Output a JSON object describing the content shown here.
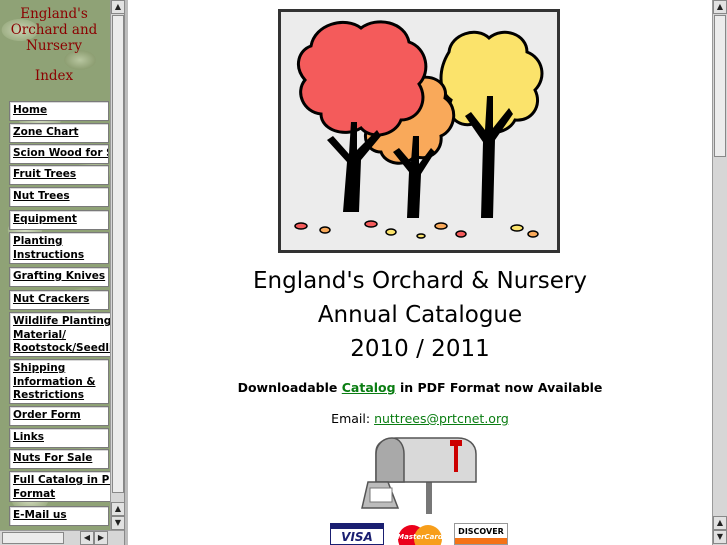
{
  "sidebar": {
    "site_title": "England's Orchard and Nursery",
    "index_label": "Index",
    "items": [
      {
        "label": "Home"
      },
      {
        "label": "Zone Chart"
      },
      {
        "label": "Scion Wood for Sale"
      },
      {
        "label": "Fruit Trees"
      },
      {
        "label": "Nut Trees"
      },
      {
        "label": "Equipment"
      },
      {
        "label": "Planting Instructions"
      },
      {
        "label": "Grafting Knives"
      },
      {
        "label": "Nut Crackers"
      },
      {
        "label": "Wildlife Planting Material/ Rootstock/Seedlings"
      },
      {
        "label": "Shipping Information & Restrictions"
      },
      {
        "label": "Order Form"
      },
      {
        "label": "Links"
      },
      {
        "label": "Nuts For Sale"
      },
      {
        "label": "Full Catalog in PDF Format"
      },
      {
        "label": "E-Mail us"
      }
    ]
  },
  "main": {
    "heading_line1": "England's Orchard & Nursery",
    "heading_line2": "Annual Catalogue",
    "heading_line3": "2010 / 2011",
    "download_prefix": "Downloadable",
    "download_link": "Catalog",
    "download_suffix": "in PDF Format now Available",
    "email_label": "Email:",
    "email_address": "nuttrees@prtcnet.org",
    "cards": [
      "VISA",
      "MasterCard",
      "DISCOVER"
    ]
  },
  "colors": {
    "title_red": "#8b0000",
    "link_green": "#0a7d12",
    "tree_red": "#f45b5b",
    "tree_orange": "#f9a95a",
    "tree_yellow": "#fbe36b"
  }
}
